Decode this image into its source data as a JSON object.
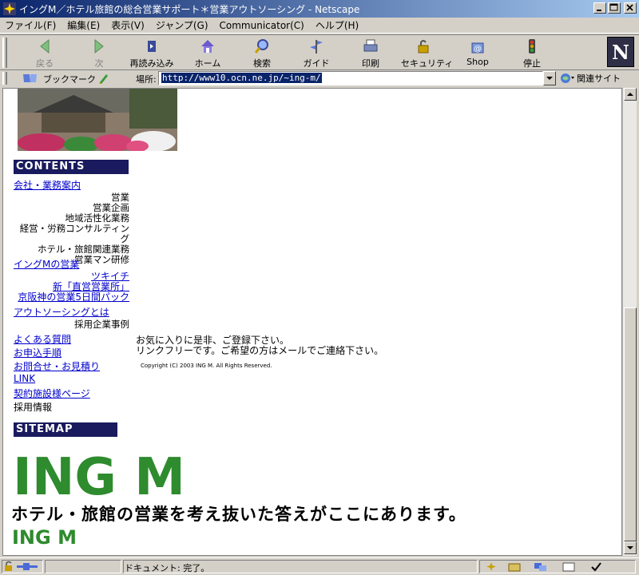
{
  "window": {
    "title": "イングM／ホテル旅館の総合営業サポート＊営業アウトソーシング - Netscape"
  },
  "menu": [
    "ファイル(F)",
    "編集(E)",
    "表示(V)",
    "ジャンプ(G)",
    "Communicator(C)",
    "ヘルプ(H)"
  ],
  "toolbar": {
    "back": "戻る",
    "forward": "次",
    "reload": "再読み込み",
    "home": "ホーム",
    "search": "検索",
    "guide": "ガイド",
    "print": "印刷",
    "security": "セキュリティ",
    "shop": "Shop",
    "stop": "停止",
    "logo": "N"
  },
  "location": {
    "bookmarks_label": "ブックマーク",
    "location_label": "場所:",
    "url": "http://www10.ocn.ne.jp/~ing-m/",
    "related_label": "関連サイト"
  },
  "sidebar": {
    "contents_header": "CONTENTS",
    "company_link": "会社・業務案内",
    "company_items": [
      "営業",
      "営業企画",
      "地域活性化業務",
      "経営・労務コンサルティング",
      "ホテル・旅館関連業務",
      "営業マン研修"
    ],
    "ingm_link": "イングMの営業",
    "ingm_sub_links": [
      "ツキイチ",
      "新「直営営業所」",
      "京阪神の営業5日間パック"
    ],
    "outsourcing_link": "アウトソーシングとは",
    "outsourcing_item": "採用企業事例",
    "other_links": [
      "よくある質問",
      "お申込手順",
      "お問合せ・お見積り",
      "LINK",
      "契約施設様ページ"
    ],
    "recruit": "採用情報",
    "sitemap_header": "SITEMAP"
  },
  "main": {
    "message_line1": "お気に入りに是非、ご登録下さい。",
    "message_line2": "リンクフリーです。ご希望の方はメールでご連絡下さい。",
    "copyright": "Copyright (C) 2003 ING M. All Rights Reserved."
  },
  "footer": {
    "logo_big": "ING M",
    "tagline": "ホテル・旅館の営業を考え抜いた答えがここにあります。",
    "logo_small": "ING M"
  },
  "status": {
    "text": "ドキュメント: 完了。"
  },
  "colors": {
    "logo_green": "#2e8b2e",
    "header_navy": "#1a1a5e",
    "link_blue": "#0000cc"
  }
}
